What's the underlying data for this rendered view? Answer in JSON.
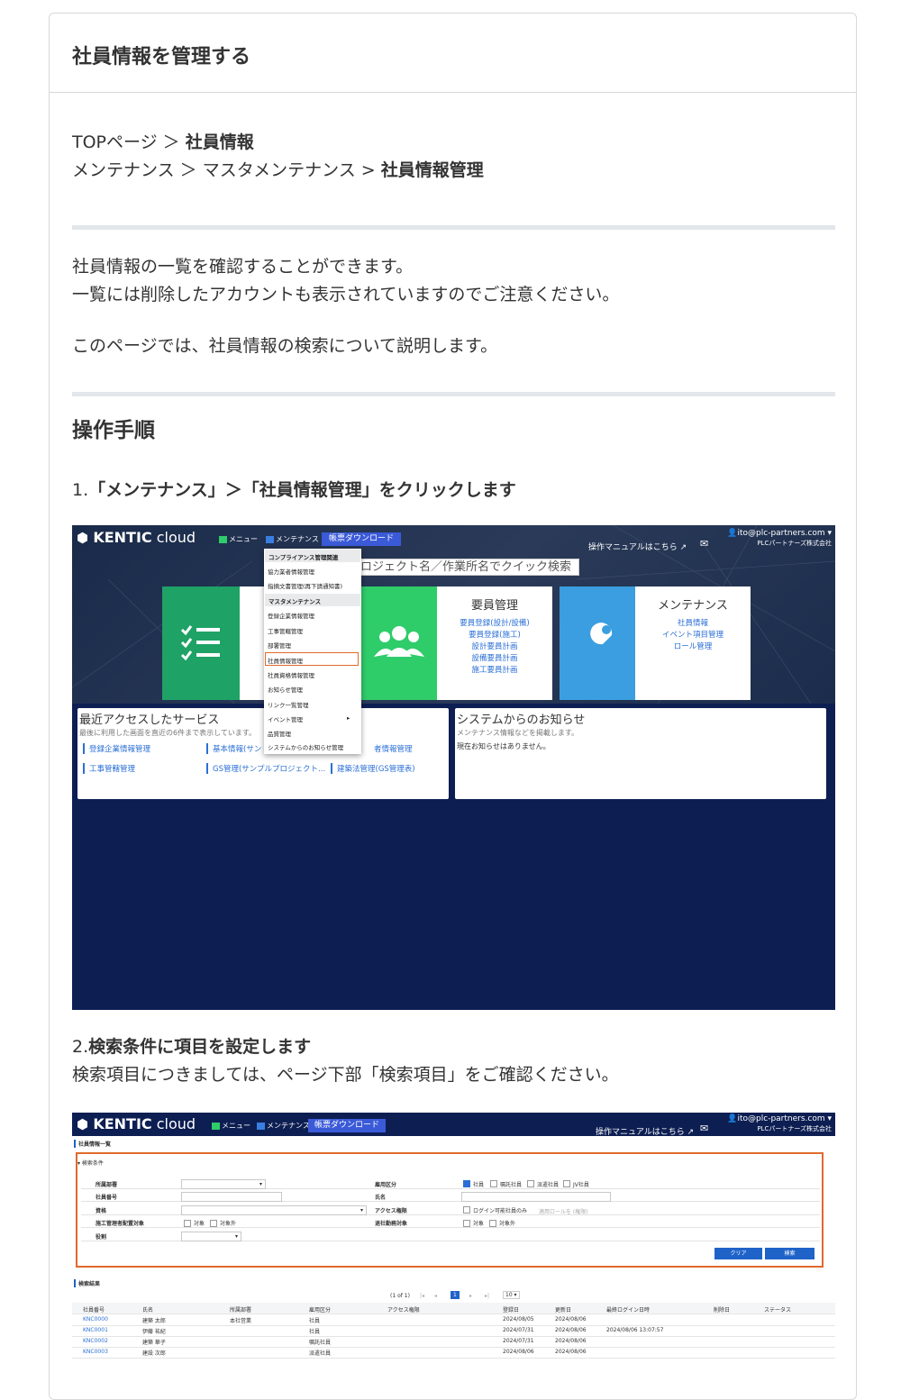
{
  "header": {
    "title": "社員情報を管理する"
  },
  "breadcrumb": {
    "line1_prefix": "TOPページ ＞ ",
    "line1_bold": "社員情報",
    "line2_prefix": "メンテナンス ＞ マスタメンテナンス > ",
    "line2_bold": "社員情報管理"
  },
  "intro": {
    "line1": "社員情報の一覧を確認することができます。",
    "line2": "一覧には削除したアカウントも表示されていますのでご注意ください。",
    "line3": "このページでは、社員情報の検索について説明します。"
  },
  "section": {
    "title": "操作手順"
  },
  "steps": [
    {
      "number": "1.",
      "text": "「メンテナンス」＞「社員情報管理」をクリックします"
    },
    {
      "number": "2.",
      "text": "検索条件に項目を設定します",
      "note": "検索項目につきましては、ページ下部「検索項目」をご確認ください。"
    }
  ],
  "screenshot1": {
    "brand_bold": "KENTIC",
    "brand_light": " cloud",
    "menu_label": "メニュー",
    "maint_label": "メンテナンス",
    "download_label": "帳票ダウンロード",
    "user_email": "ito@plc-partners.com ▾",
    "company": "PLCパートナーズ株式会社",
    "manual_link": "操作マニュアルはこちら",
    "search_placeholder": "ロジェクト名／作業所名でクイック検索",
    "dropdown": {
      "head1": "コンプライアンス管理関連",
      "items_a": [
        "協力業者情報管理",
        "指摘文書管理(再下請通知書)"
      ],
      "head2": "マスタメンテナンス",
      "items_b": [
        "登録企業情報管理",
        "工事管轄管理",
        "部署管理",
        "社員情報管理",
        "社員資格情報管理",
        "お知らせ管理",
        "リンク一覧管理",
        "イベント管理",
        "品質管理",
        "システムからのお知らせ管理"
      ]
    },
    "tile_staff": {
      "title": "要員管理",
      "links": [
        "要員登録(設計/設備)",
        "要員登録(施工)",
        "設計要員計画",
        "設備要員計画",
        "施工要員計画"
      ]
    },
    "tile_maint": {
      "title": "メンテナンス",
      "links": [
        "社員情報",
        "イベント項目管理",
        "ロール管理"
      ]
    },
    "recent": {
      "title": "最近アクセスしたサービス",
      "sub": "最後に利用した画面を直近の6件まで表示しています。",
      "links": [
        "登録企業情報管理",
        "基本情報(サン",
        "者情報管理",
        "工事管轄管理",
        "GS管理(サンプルプロジェクト...",
        "建築法管理(GS管理表)"
      ]
    },
    "notice": {
      "title": "システムからのお知らせ",
      "sub": "メンテナンス情報などを掲載します。",
      "body": "現在お知らせはありません。"
    }
  },
  "screenshot2": {
    "page_title": "社員情報一覧",
    "cond_title": "▾ 検索条件",
    "left_labels": [
      "所属部署",
      "社員番号",
      "資格",
      "施工管理者配置対象",
      "役割"
    ],
    "right_labels": [
      "雇用区分",
      "氏名",
      "アクセス権限",
      "退社勤務対象"
    ],
    "emp_types": [
      "社員",
      "嘱託社員",
      "派遣社員",
      "JV社員"
    ],
    "login_only": "ログイン可能社員のみ",
    "login_select": "適用ロールを (権限)",
    "target_opts": [
      "対象",
      "対象外"
    ],
    "btn_clear": "クリア",
    "btn_search": "検索",
    "result_title": "検索結果",
    "pager": "(1 of 1)",
    "pager_page": "1",
    "pager_size": "10 ▾",
    "columns": [
      "社員番号",
      "氏名",
      "所属部署",
      "雇用区分",
      "アクセス権限",
      "登録日",
      "更新日",
      "最終ログイン日時",
      "削除日",
      "ステータス"
    ],
    "rows": [
      [
        "KNC0000",
        "建築 太郎",
        "本社営業",
        "社員",
        "",
        "2024/08/05",
        "2024/08/06",
        "",
        "",
        ""
      ],
      [
        "KNC0001",
        "伊藤 祐紀",
        "",
        "社員",
        "",
        "2024/07/31",
        "2024/08/06",
        "2024/08/06 13:07:57",
        "",
        ""
      ],
      [
        "KNC0002",
        "建築 華子",
        "",
        "嘱託社員",
        "",
        "2024/07/31",
        "2024/08/06",
        "",
        "",
        ""
      ],
      [
        "KNC0003",
        "建設 次郎",
        "",
        "派遣社員",
        "",
        "2024/08/06",
        "2024/08/06",
        "",
        "",
        ""
      ]
    ]
  },
  "colors": {
    "navy": "#0d1e52",
    "accent_orange": "#e06a2c",
    "link_blue": "#2b6fd6",
    "tile_green": "#1fa266",
    "tile_green2": "#2fcc6a",
    "tile_blue": "#3a9ee0"
  }
}
